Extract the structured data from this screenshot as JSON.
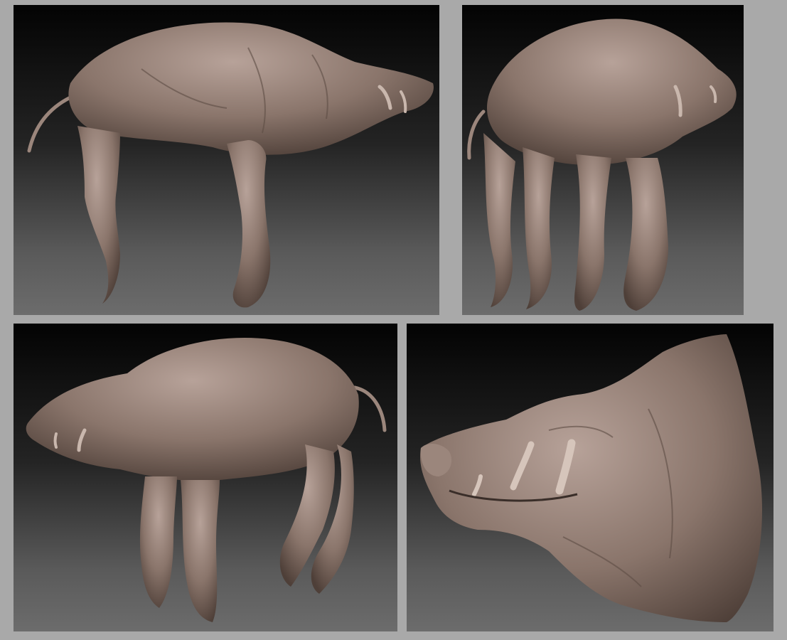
{
  "gallery": {
    "background": "#a9a9a9",
    "panel_gradient": [
      "#030303",
      "#6c6c6c"
    ],
    "sculpt_color": "#8a756b",
    "panels": [
      {
        "view": "side-right"
      },
      {
        "view": "three-quarter-front"
      },
      {
        "view": "side-left"
      },
      {
        "view": "head-closeup"
      }
    ]
  }
}
